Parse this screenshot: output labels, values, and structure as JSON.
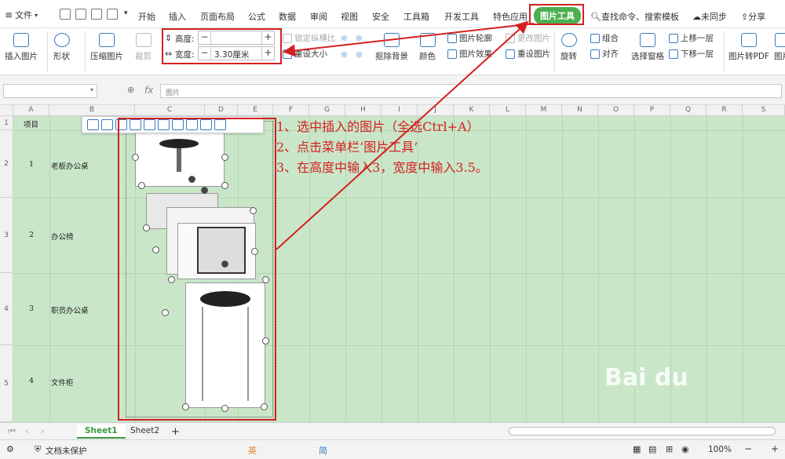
{
  "file_menu": {
    "label": "文件"
  },
  "tabs": [
    "开始",
    "插入",
    "页面布局",
    "公式",
    "数据",
    "审阅",
    "视图",
    "安全",
    "工具箱",
    "开发工具",
    "特色应用"
  ],
  "active_tab": "图片工具",
  "search": {
    "label": "查找命令、搜索模板"
  },
  "sync": {
    "label": "未同步"
  },
  "share": {
    "label": "分享"
  },
  "ribbon": {
    "insert_picture": "插入图片",
    "shape": "形状",
    "compress": "压缩图片",
    "crop": "裁剪",
    "height_label": "高度:",
    "height_value": "",
    "width_label": "宽度:",
    "width_value": "3.30厘米",
    "lock_ratio": "锁定纵横比",
    "reset_size": "重设大小",
    "remove_bg": "抠除背景",
    "color": "颜色",
    "outline": "图片轮廓",
    "change_pic": "更改图片",
    "effects": "图片效果",
    "reset_pic": "重设图片",
    "rotate": "旋转",
    "group": "组合",
    "align": "对齐",
    "selection_pane": "选择窗格",
    "bring_forward": "上移一层",
    "send_backward": "下移一层",
    "to_pdf": "图片转PDF",
    "pic_more": "图片"
  },
  "formula_bar": {
    "fx": "fx",
    "content": "图片"
  },
  "columns": [
    "A",
    "B",
    "C",
    "D",
    "E",
    "F",
    "G",
    "H",
    "I",
    "J",
    "K",
    "L",
    "M",
    "N",
    "O",
    "P",
    "Q",
    "R",
    "S"
  ],
  "rows": [
    "1",
    "2",
    "3",
    "4",
    "5"
  ],
  "cells": {
    "header": "项目",
    "r2_num": "1",
    "r2_name": "老板办公桌",
    "r3_num": "2",
    "r3_name": "办公椅",
    "r4_num": "3",
    "r4_name": "职员办公桌",
    "r5_num": "4",
    "r5_name": "文件柜"
  },
  "annotations": [
    "1、选中插入的图片（全选Ctrl+A）",
    "2、点击菜单栏‘图片工具’",
    "3、在高度中输入3，宽度中输入3.5。"
  ],
  "sheets": [
    "Sheet1",
    "Sheet2"
  ],
  "add_sheet": "+",
  "status": {
    "protect": "文档未保护",
    "ime": "英",
    "ime2": "简",
    "zoom": "100%"
  },
  "accent_color": "#4caf50",
  "annotation_color": "#d42020"
}
